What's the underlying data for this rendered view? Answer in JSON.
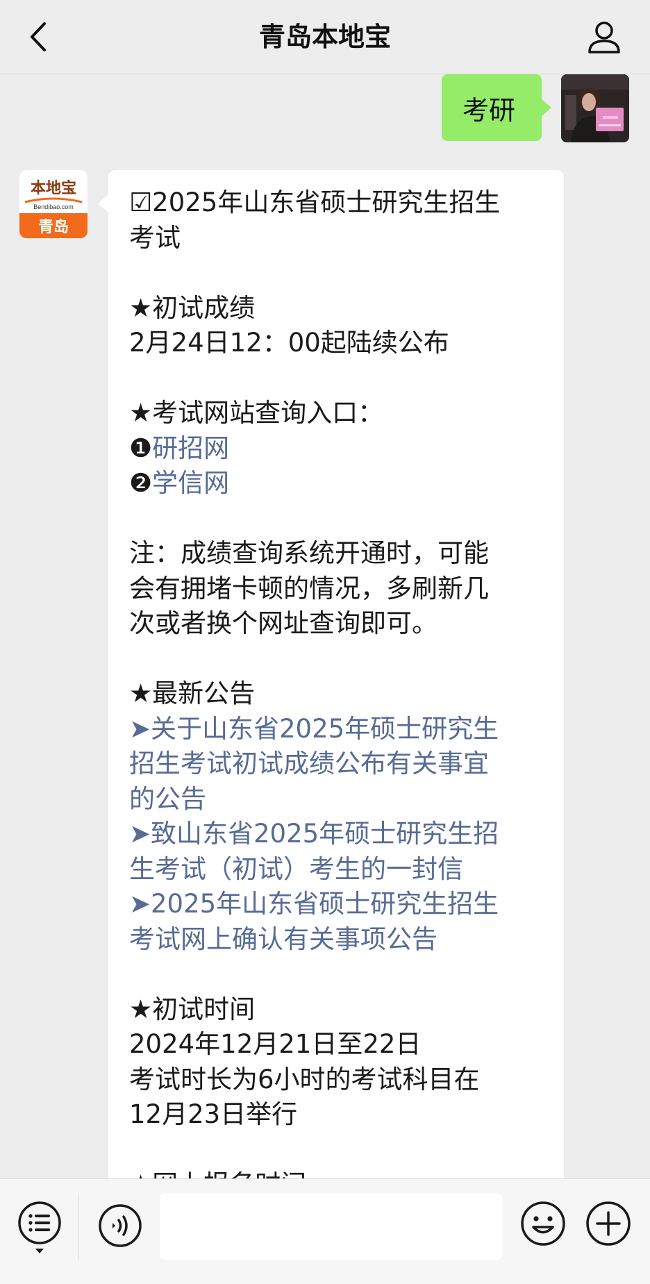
{
  "header": {
    "title": "青岛本地宝"
  },
  "outgoing": {
    "text": "考研"
  },
  "bot": {
    "logo_top": "本地宝",
    "logo_domain": "Bendibao.com",
    "logo_city": "青岛"
  },
  "message": {
    "title_1": "☑2025年山东省硕士研究生招生",
    "title_2": "考试",
    "s1_heading": "★初试成绩",
    "s1_text": "2月24日12：00起陆续公布",
    "s2_heading": "★考试网站查询入口：",
    "s2_link1_num": "❶",
    "s2_link1": "研招网",
    "s2_link2_num": "❷",
    "s2_link2": "学信网",
    "note_1": "注：成绩查询系统开通时，可能",
    "note_2": "会有拥堵卡顿的情况，多刷新几",
    "note_3": "次或者换个网址查询即可。",
    "s3_heading": "★最新公告",
    "a1_1": "➤关于山东省2025年硕士研究生",
    "a1_2": "招生考试初试成绩公布有关事宜",
    "a1_3": "的公告",
    "a2_1": "➤致山东省2025年硕士研究生招",
    "a2_2": "生考试（初试）考生的一封信",
    "a3_1": "➤2025年山东省硕士研究生招生",
    "a3_2": "考试网上确认有关事项公告",
    "s4_heading": "★初试时间",
    "s4_line1": "2024年12月21日至22日",
    "s4_line2": "考试时长为6小时的考试科目在",
    "s4_line3": "12月23日举行",
    "s5_heading_partial": "★网上报名时间"
  },
  "input": {
    "value": ""
  },
  "colors": {
    "accent_green": "#95ec69",
    "link_blue": "#576b95",
    "logo_orange": "#f26a1b"
  }
}
